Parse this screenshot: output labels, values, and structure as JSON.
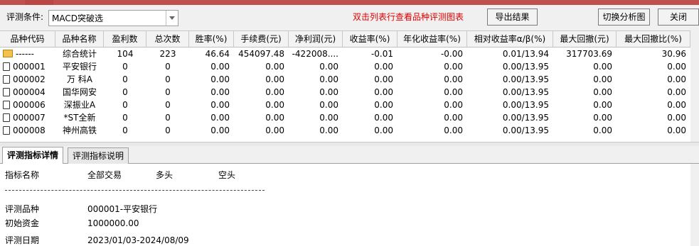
{
  "toolbar": {
    "condition_label": "评测条件:",
    "condition_value": "MACD突破选",
    "hint": "双击列表行查看品种评测图表",
    "export_label": "导出结果",
    "switch_label": "切换分析图",
    "close_label": "关闭"
  },
  "table": {
    "columns": [
      "品种代码",
      "品种名称",
      "盈利数",
      "总次数",
      "胜率(%)",
      "手续费(元)",
      "净利润(元)",
      "收益率(%)",
      "年化收益率(%)",
      "相对收益率α/β(%)",
      "最大回撤(元)",
      "最大回撤比(%)"
    ],
    "rows": [
      {
        "icon": "folder-icon",
        "code": "------",
        "name": "综合统计",
        "wins": "104",
        "total": "223",
        "win_rate": "46.64",
        "fee": "454097.48",
        "net_profit": "-422008....",
        "return": "-0.01",
        "annual": "-0.00",
        "relative": "0.01/13.94",
        "max_dd": "317703.69",
        "max_dd_ratio": "30.96"
      },
      {
        "icon": "document-icon",
        "code": "000001",
        "name": "平安银行",
        "wins": "0",
        "total": "0",
        "win_rate": "0.00",
        "fee": "0.00",
        "net_profit": "0.00",
        "return": "0.00",
        "annual": "0.00",
        "relative": "0.00/13.95",
        "max_dd": "0.00",
        "max_dd_ratio": "0.00"
      },
      {
        "icon": "document-icon",
        "code": "000002",
        "name": "万 科A",
        "wins": "0",
        "total": "0",
        "win_rate": "0.00",
        "fee": "0.00",
        "net_profit": "0.00",
        "return": "0.00",
        "annual": "0.00",
        "relative": "0.00/13.95",
        "max_dd": "0.00",
        "max_dd_ratio": "0.00"
      },
      {
        "icon": "document-icon",
        "code": "000004",
        "name": "国华网安",
        "wins": "0",
        "total": "0",
        "win_rate": "0.00",
        "fee": "0.00",
        "net_profit": "0.00",
        "return": "0.00",
        "annual": "0.00",
        "relative": "0.00/13.95",
        "max_dd": "0.00",
        "max_dd_ratio": "0.00"
      },
      {
        "icon": "document-icon",
        "code": "000006",
        "name": "深振业A",
        "wins": "0",
        "total": "0",
        "win_rate": "0.00",
        "fee": "0.00",
        "net_profit": "0.00",
        "return": "0.00",
        "annual": "0.00",
        "relative": "0.00/13.95",
        "max_dd": "0.00",
        "max_dd_ratio": "0.00"
      },
      {
        "icon": "document-icon",
        "code": "000007",
        "name": "*ST全新",
        "wins": "0",
        "total": "0",
        "win_rate": "0.00",
        "fee": "0.00",
        "net_profit": "0.00",
        "return": "0.00",
        "annual": "0.00",
        "relative": "0.00/13.95",
        "max_dd": "0.00",
        "max_dd_ratio": "0.00"
      },
      {
        "icon": "document-icon",
        "code": "000008",
        "name": "神州高铁",
        "wins": "0",
        "total": "0",
        "win_rate": "0.00",
        "fee": "0.00",
        "net_profit": "0.00",
        "return": "0.00",
        "annual": "0.00",
        "relative": "0.00/13.95",
        "max_dd": "0.00",
        "max_dd_ratio": "0.00"
      }
    ]
  },
  "tabs": [
    "评测指标详情",
    "评测指标说明"
  ],
  "detail": {
    "headers": [
      "指标名称",
      "全部交易",
      "多头",
      "空头"
    ],
    "items": [
      {
        "label": "评测品种",
        "value": "000001-平安银行"
      },
      {
        "label": "初始资金",
        "value": "1000000.00"
      },
      {
        "label": "评测日期",
        "value": "2023/01/03-2024/08/09"
      }
    ]
  },
  "colors": {
    "hint": "#e00000",
    "titlebar": "#c0504d"
  }
}
